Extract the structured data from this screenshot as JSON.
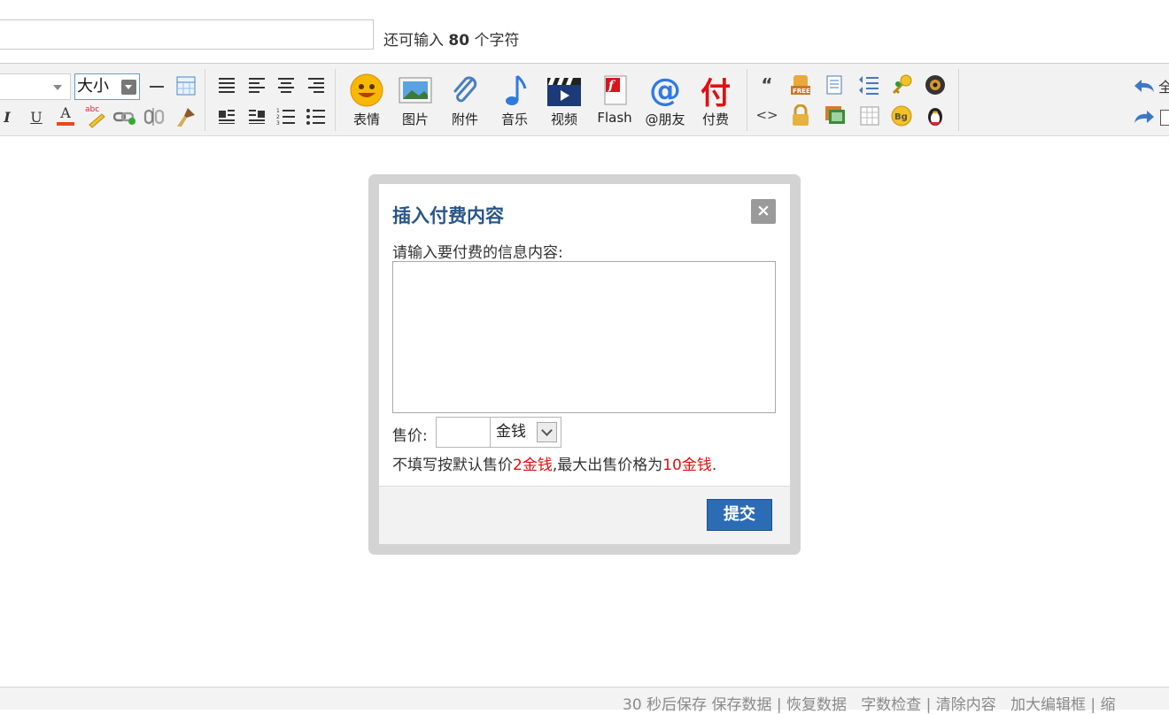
{
  "subject": {
    "value": "",
    "hint_prefix": "还可输入",
    "hint_count": "80",
    "hint_suffix": "个字符"
  },
  "toolbar": {
    "font_size_label": "大小",
    "buttons": [
      {
        "label": "表情",
        "icon": "smiley-icon"
      },
      {
        "label": "图片",
        "icon": "image-icon"
      },
      {
        "label": "附件",
        "icon": "paperclip-icon"
      },
      {
        "label": "音乐",
        "icon": "music-note-icon"
      },
      {
        "label": "视频",
        "icon": "video-clapper-icon"
      },
      {
        "label": "Flash",
        "icon": "flash-icon"
      },
      {
        "label": "@朋友",
        "icon": "at-sign-icon"
      },
      {
        "label": "付费",
        "icon": "paid-content-icon"
      }
    ],
    "paid_icon_glyph": "付",
    "at_glyph": "@",
    "bold_text_glyphs": {
      "italic": "I",
      "underline": "U",
      "font_color": "A",
      "abc": "abc",
      "quote": "“",
      "code": "<>",
      "free": "FREE",
      "bg": "Bg"
    },
    "right_partial_glyph": "全"
  },
  "dialog": {
    "title": "插入付费内容",
    "close_glyph": "×",
    "prompt": "请输入要付费的信息内容:",
    "content_value": "",
    "price_label": "售价:",
    "price_value": "",
    "currency": "金钱",
    "note_a": "不填写按默认售价",
    "note_b": "2金钱",
    "note_c": ",最大出售价格为",
    "note_d": "10金钱",
    "note_e": ".",
    "submit_label": "提交"
  },
  "status_bar": {
    "autosave": "30 秒后保存",
    "save": "保存数据",
    "sep": "|",
    "restore": "恢复数据",
    "wordcheck": "字数检查",
    "clear": "清除内容",
    "enlarge": "加大编辑框",
    "shrink_partial": "缩"
  },
  "colors": {
    "accent_blue": "#2b6cb5",
    "title_blue": "#2a5688",
    "warning_red": "#e01010"
  }
}
